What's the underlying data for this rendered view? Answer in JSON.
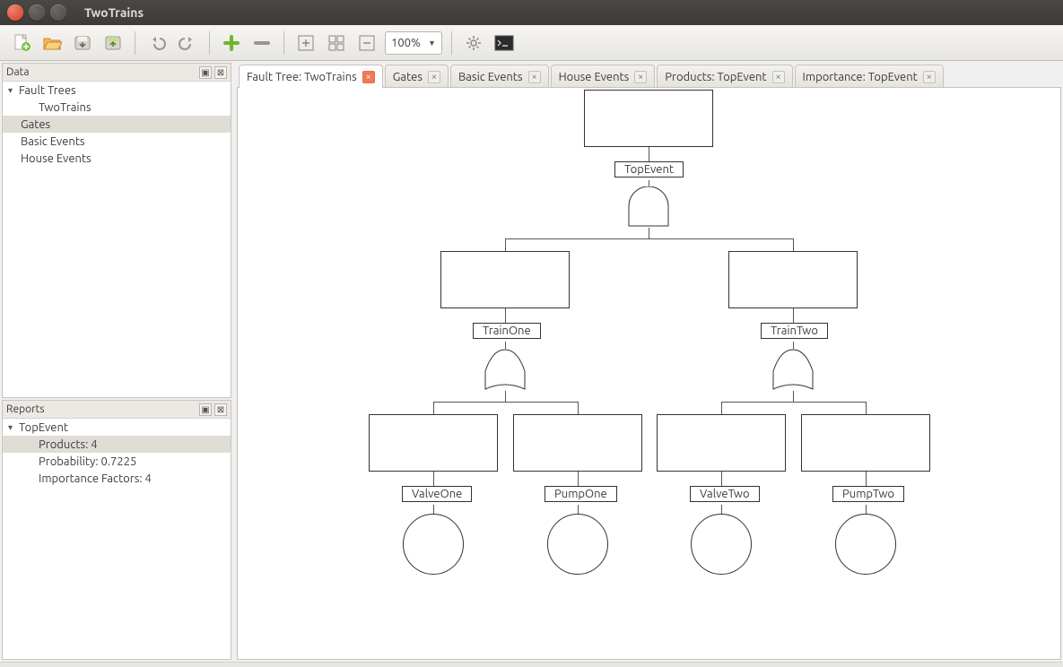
{
  "window": {
    "title": "TwoTrains"
  },
  "toolbar": {
    "zoom": "100%"
  },
  "panels": {
    "data": {
      "title": "Data"
    },
    "reports": {
      "title": "Reports"
    }
  },
  "data_tree": {
    "root": "Fault Trees",
    "items": [
      "TwoTrains",
      "Gates",
      "Basic Events",
      "House Events"
    ],
    "selected": "Gates"
  },
  "reports_tree": {
    "root": "TopEvent",
    "items": [
      "Products: 4",
      "Probability: 0.7225",
      "Importance Factors: 4"
    ],
    "selected": "Products: 4"
  },
  "tabs": [
    {
      "label": "Fault Tree: TwoTrains",
      "active": true
    },
    {
      "label": "Gates",
      "active": false
    },
    {
      "label": "Basic Events",
      "active": false
    },
    {
      "label": "House Events",
      "active": false
    },
    {
      "label": "Products: TopEvent",
      "active": false
    },
    {
      "label": "Importance: TopEvent",
      "active": false
    }
  ],
  "diagram": {
    "top": {
      "name": "TopEvent",
      "gate": "AND"
    },
    "mid": [
      {
        "name": "TrainOne",
        "gate": "OR"
      },
      {
        "name": "TrainTwo",
        "gate": "OR"
      }
    ],
    "leaves": [
      "ValveOne",
      "PumpOne",
      "ValveTwo",
      "PumpTwo"
    ]
  }
}
